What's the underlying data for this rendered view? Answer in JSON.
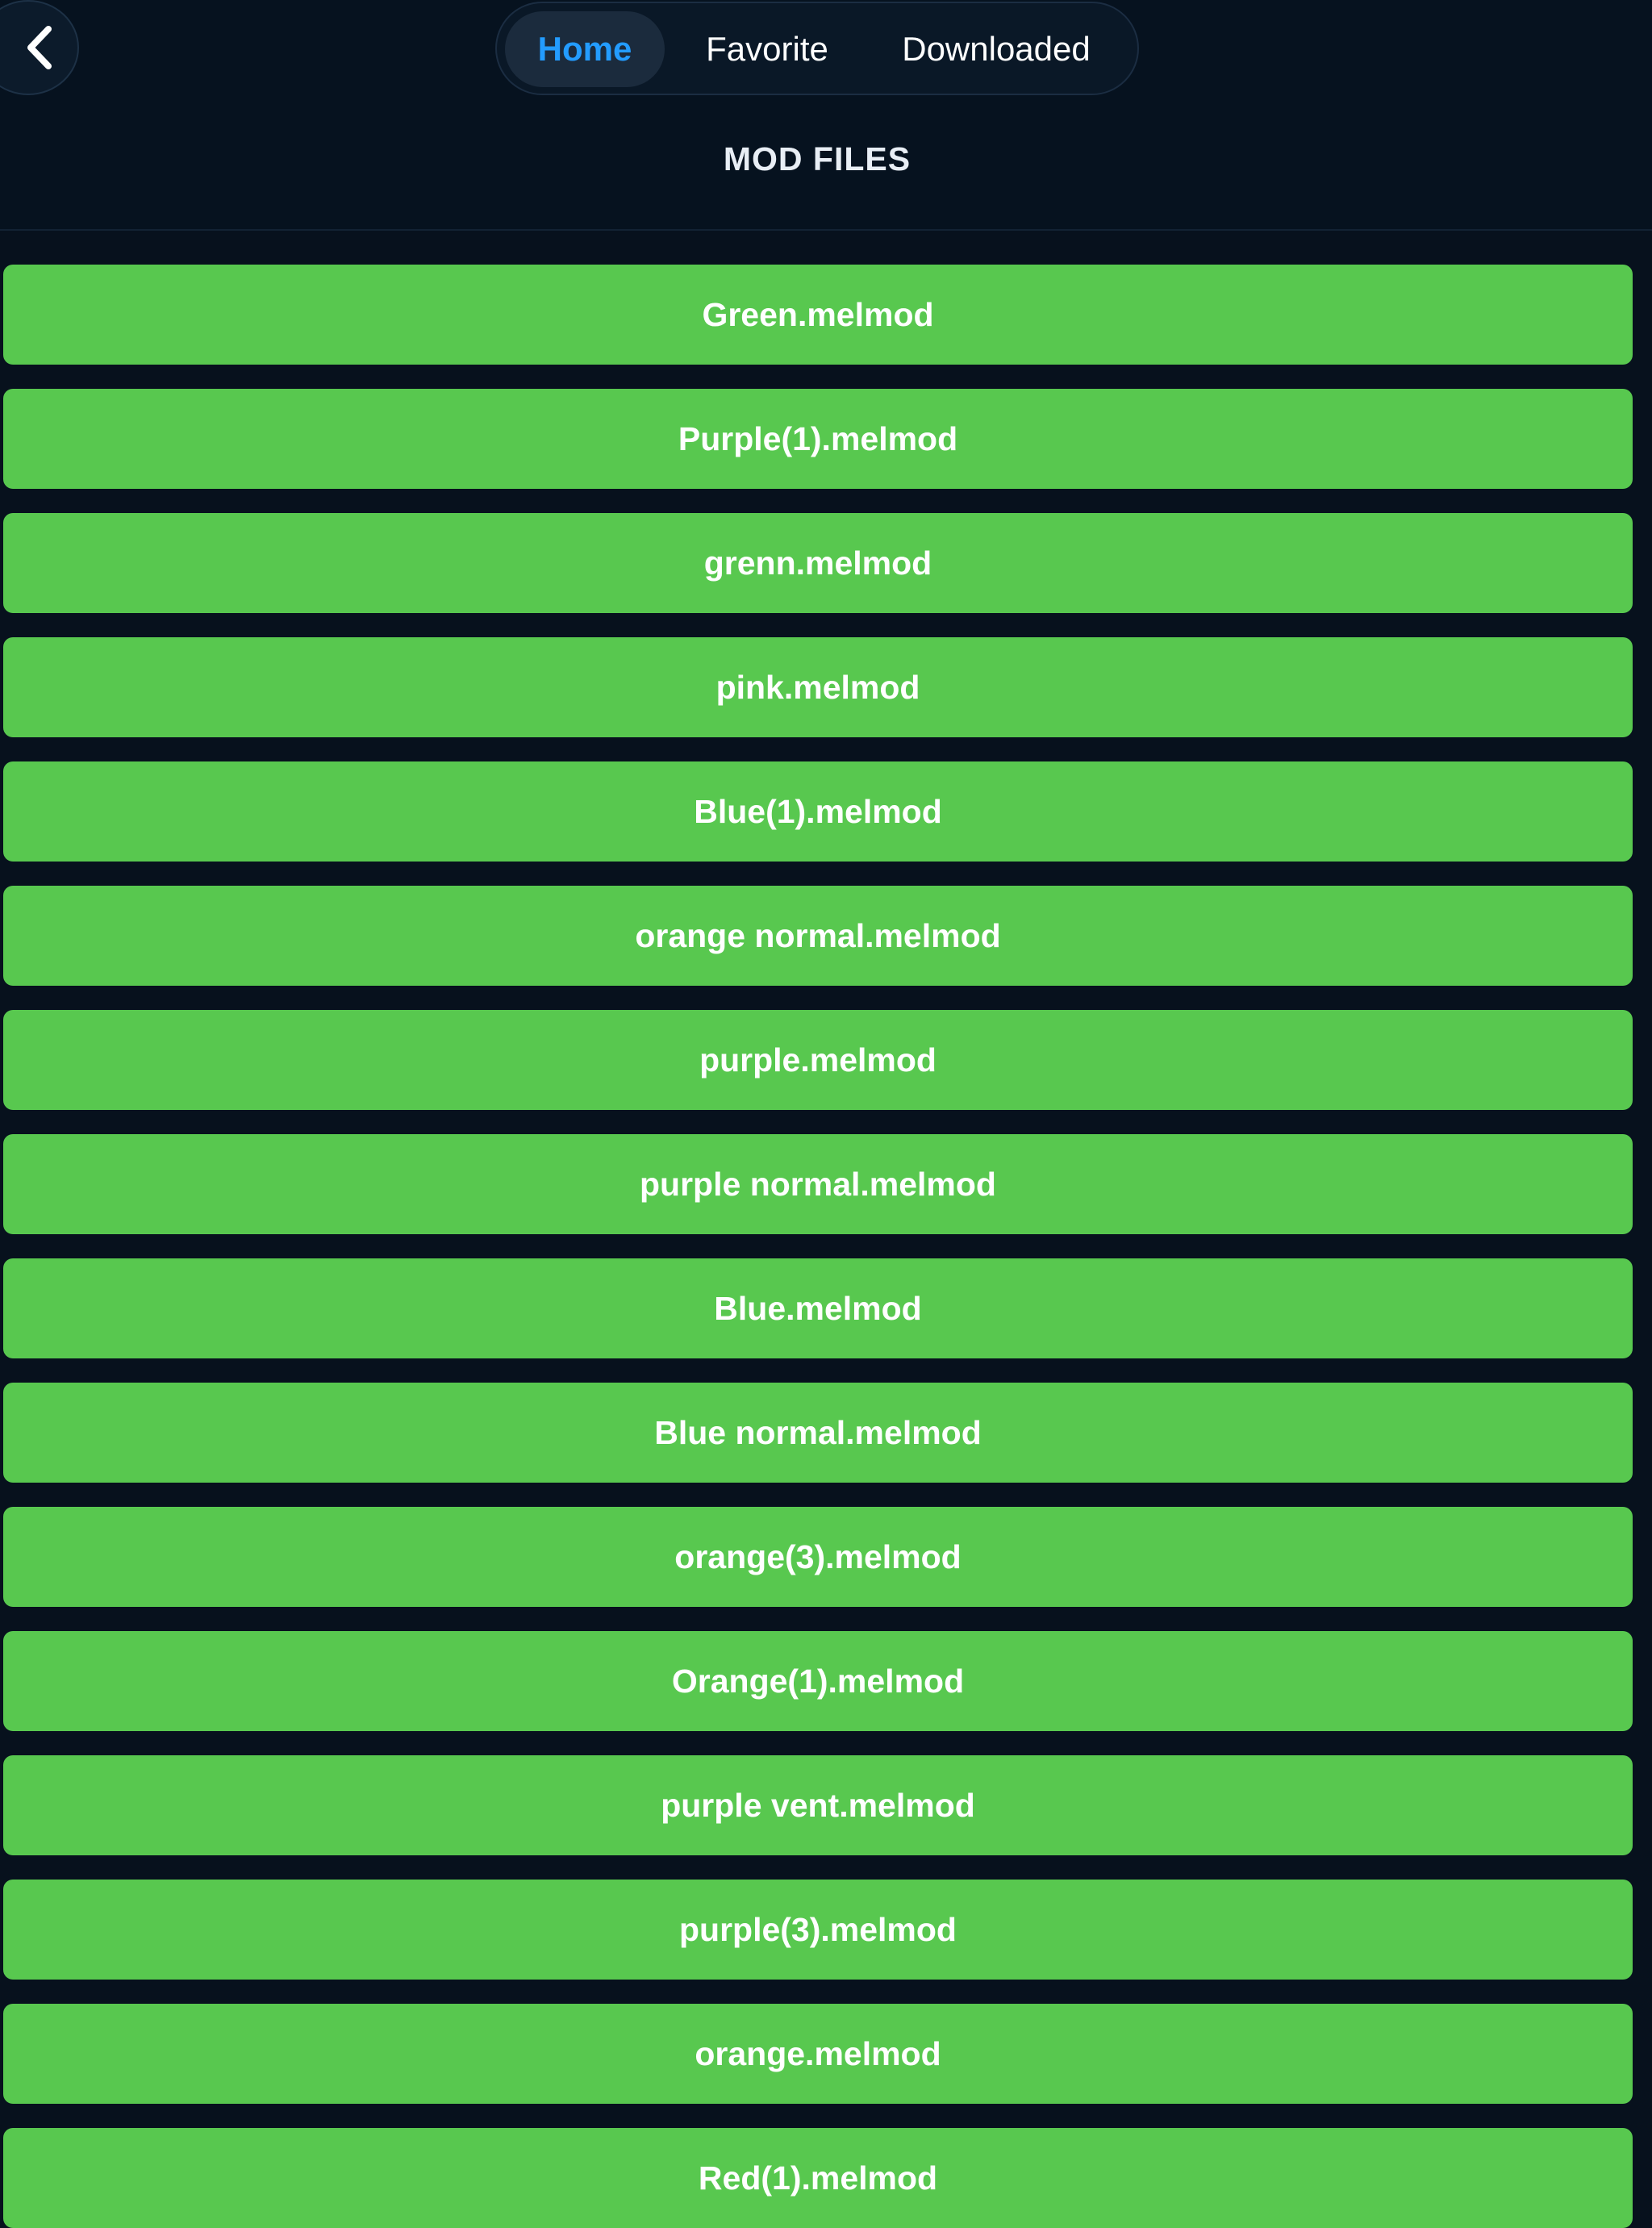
{
  "header": {
    "tabs": [
      {
        "label": "Home",
        "active": true
      },
      {
        "label": "Favorite",
        "active": false
      },
      {
        "label": "Downloaded",
        "active": false
      }
    ],
    "title": "MOD FILES"
  },
  "files": [
    "Green.melmod",
    "Purple(1).melmod",
    "grenn.melmod",
    "pink.melmod",
    "Blue(1).melmod",
    "orange normal.melmod",
    "purple.melmod",
    "purple normal.melmod",
    "Blue.melmod",
    "Blue normal.melmod",
    "orange(3).melmod",
    "Orange(1).melmod",
    "purple vent.melmod",
    "purple(3).melmod",
    "orange.melmod",
    "Red(1).melmod"
  ],
  "icons": {
    "back": "chevron-left-icon"
  },
  "colors": {
    "background": "#07111d",
    "accent": "#239cff",
    "file_button": "#58c84f"
  }
}
